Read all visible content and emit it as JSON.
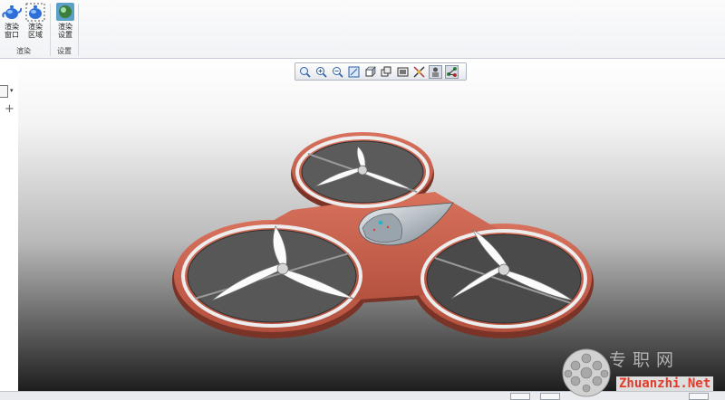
{
  "ribbon": {
    "buttons": [
      {
        "label": "渲染窗口",
        "icon": "teapot-icon"
      },
      {
        "label": "渲染区域",
        "icon": "teapot-region-icon"
      },
      {
        "label": "渲染设置",
        "icon": "render-settings-icon"
      }
    ],
    "groups": [
      {
        "label": "渲染"
      },
      {
        "label": "设置"
      }
    ]
  },
  "view_toolbar": {
    "tools": [
      {
        "icon": "zoom-fit-icon"
      },
      {
        "icon": "zoom-in-icon"
      },
      {
        "icon": "zoom-out-icon"
      },
      {
        "icon": "zoom-window-icon"
      },
      {
        "icon": "view-orientation-icon"
      },
      {
        "icon": "display-style-icon"
      },
      {
        "icon": "section-view-icon"
      },
      {
        "icon": "explode-icon"
      },
      {
        "icon": "annotation-display-icon",
        "active": true
      },
      {
        "icon": "model-tree-icon",
        "active": true
      }
    ]
  },
  "model": {
    "colors": {
      "frame": "#c9624f",
      "frame_shadow": "#7a3327",
      "ring": "#e8e8e8",
      "blade": "#fbfbfb",
      "hub": "#9aa4ad"
    }
  },
  "watermark": {
    "title": "专职网",
    "url": "Zhuanzhi.Net"
  }
}
